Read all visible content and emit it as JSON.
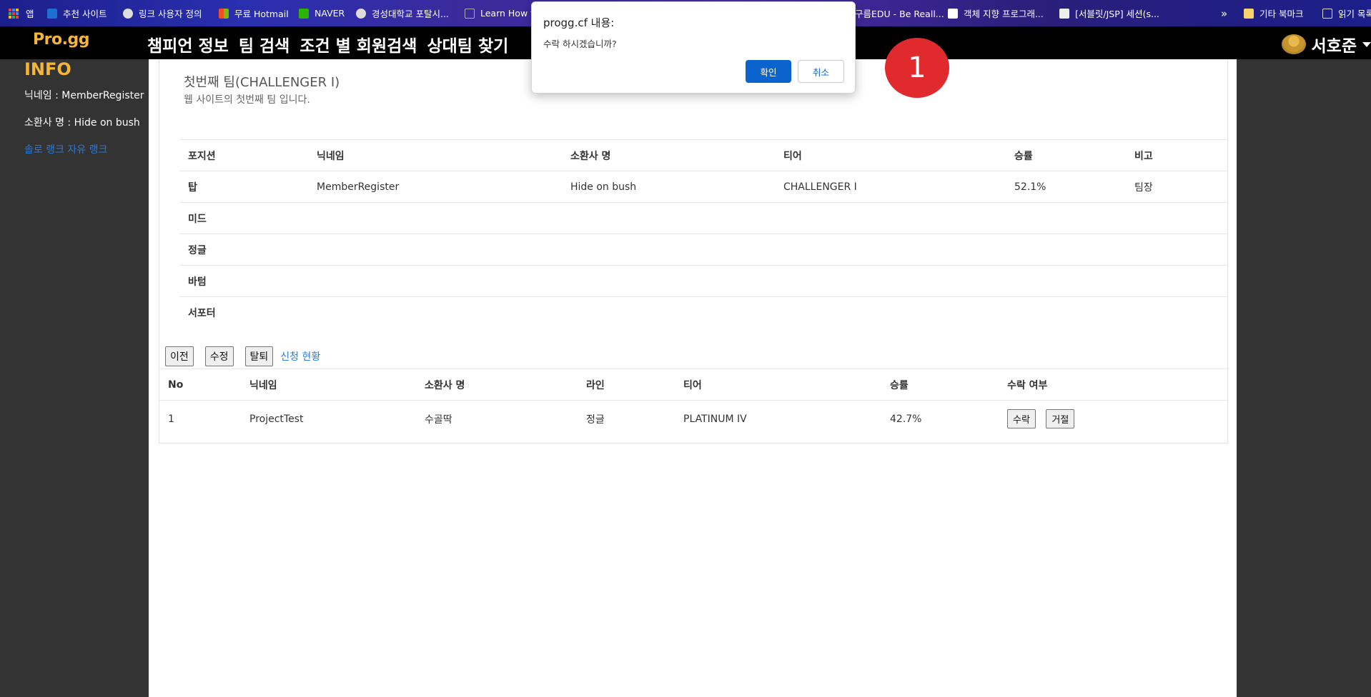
{
  "bookmarks": [
    {
      "label": "앱"
    },
    {
      "label": "추천 사이트"
    },
    {
      "label": "링크 사용자 정의"
    },
    {
      "label": "무료 Hotmail"
    },
    {
      "label": "NAVER"
    },
    {
      "label": "경성대학교 포탈시..."
    },
    {
      "label": "Learn How t"
    },
    {
      "label": "구름EDU - Be Reall..."
    },
    {
      "label": "객체 지향 프로그래..."
    },
    {
      "label": "[서블릿/JSP] 세션(s..."
    },
    {
      "label": "»"
    },
    {
      "label": "기타 북마크"
    },
    {
      "label": "읽기 목록"
    }
  ],
  "navbar": {
    "logo": "Pro.gg",
    "links": [
      "챔피언 정보",
      "팀 검색",
      "조건 별 회원검색",
      "상대팀 찾기"
    ],
    "user_name": "서호준"
  },
  "sidebar": {
    "title": "INFO",
    "nickname_line": "닉네임 : MemberRegister",
    "summoner_line": "소환사 명 : Hide on bush",
    "rank_link": "솔로 랭크 자유 랭크"
  },
  "team": {
    "title": "첫번째 팀(CHALLENGER I)",
    "description": "웹 사이트의 첫번째 팀 입니다."
  },
  "members_table": {
    "headers": [
      "포지션",
      "닉네임",
      "소환사 명",
      "티어",
      "승률",
      "비고"
    ],
    "rows": [
      {
        "position": "탑",
        "nickname": "MemberRegister",
        "summoner": "Hide on bush",
        "tier": "CHALLENGER I",
        "winrate": "52.1%",
        "note": "팀장"
      },
      {
        "position": "미드",
        "nickname": "",
        "summoner": "",
        "tier": "",
        "winrate": "",
        "note": ""
      },
      {
        "position": "정글",
        "nickname": "",
        "summoner": "",
        "tier": "",
        "winrate": "",
        "note": ""
      },
      {
        "position": "바텀",
        "nickname": "",
        "summoner": "",
        "tier": "",
        "winrate": "",
        "note": ""
      },
      {
        "position": "서포터",
        "nickname": "",
        "summoner": "",
        "tier": "",
        "winrate": "",
        "note": ""
      }
    ]
  },
  "actions": {
    "prev": "이전",
    "edit": "수정",
    "leave": "탈퇴",
    "apply_status": "신청 현황"
  },
  "applications_table": {
    "headers": [
      "No",
      "닉네임",
      "소환사 명",
      "라인",
      "티어",
      "승률",
      "수락 여부"
    ],
    "rows": [
      {
        "no": "1",
        "nickname": "ProjectTest",
        "summoner": "수골딱",
        "line": "정글",
        "tier": "PLATINUM IV",
        "winrate": "42.7%",
        "accept": "수락",
        "reject": "거절"
      }
    ]
  },
  "dialog": {
    "title": "progg.cf 내용:",
    "message": "수락 하시겠습니까?",
    "ok": "확인",
    "cancel": "취소"
  },
  "step_badge": "1",
  "colors": {
    "accent": "#f3b53a",
    "primary_button": "#0b63ce",
    "link": "#2a49d6",
    "badge": "#e02a2e"
  }
}
